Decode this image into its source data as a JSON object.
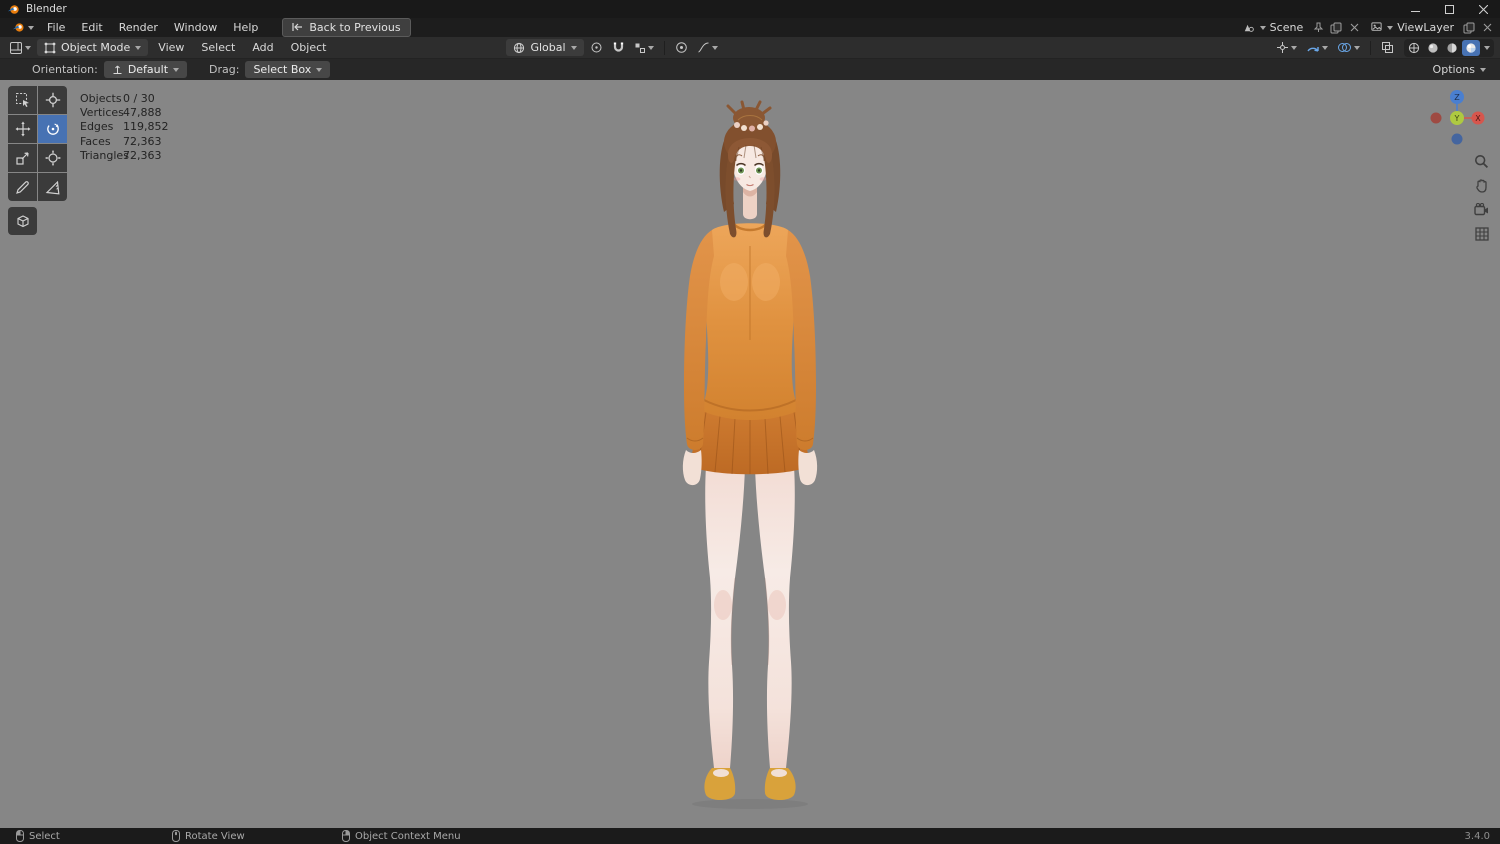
{
  "titlebar": {
    "app_title": "Blender"
  },
  "menubar": {
    "items": [
      "File",
      "Edit",
      "Render",
      "Window",
      "Help"
    ],
    "back_button": "Back to Previous",
    "scene": {
      "label": "Scene"
    },
    "viewlayer": {
      "label": "ViewLayer"
    }
  },
  "toolheader": {
    "mode": "Object Mode",
    "menus": [
      "View",
      "Select",
      "Add",
      "Object"
    ],
    "orientation": "Global"
  },
  "subheader": {
    "orientation_label": "Orientation:",
    "orientation_value": "Default",
    "drag_label": "Drag:",
    "drag_value": "Select Box",
    "options": "Options"
  },
  "viewport": {
    "stats": [
      {
        "label": "Objects",
        "value": "0 / 30"
      },
      {
        "label": "Vertices",
        "value": "47,888"
      },
      {
        "label": "Edges",
        "value": "119,852"
      },
      {
        "label": "Faces",
        "value": "72,363"
      },
      {
        "label": "Triangles",
        "value": "72,363"
      }
    ],
    "gizmo_axes": {
      "x": "X",
      "y": "Y",
      "z": "Z"
    }
  },
  "statusbar": {
    "select": "Select",
    "rotate_view": "Rotate View",
    "context_menu": "Object Context Menu",
    "version": "3.4.0"
  },
  "colors": {
    "accent_blue": "#4772b3",
    "axis_x": "#e0544c",
    "axis_y": "#aac73f",
    "axis_z": "#4a7fd0",
    "sweater_orange": "#e09240",
    "skirt_orange": "#c9752e"
  }
}
